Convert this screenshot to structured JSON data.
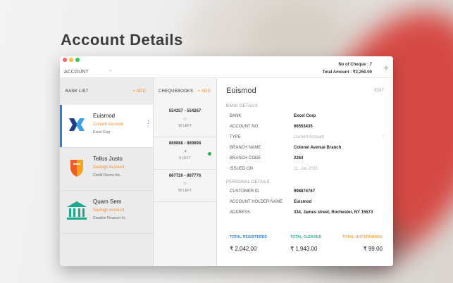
{
  "page": {
    "heading": "Account Details"
  },
  "toolbar": {
    "account_select": "ACCOUNT",
    "cheque_count_label": "No of Cheque :",
    "cheque_count": "7",
    "total_amount_label": "Total Amount :",
    "total_amount": "₹2,250.00",
    "add_symbol": "+"
  },
  "bank_list": {
    "header": "BANK LIST",
    "add_label": "+ ADD",
    "items": [
      {
        "name": "Euismod",
        "account_type": "Current Account",
        "subtitle": "Excel Corp",
        "logo": "x-chevron-logo",
        "selected": true
      },
      {
        "name": "Tellus Justo",
        "account_type": "Savings Account",
        "subtitle": "Credit Device Inc.",
        "logo": "shield-logo",
        "selected": false
      },
      {
        "name": "Quam Sem",
        "account_type": "Savings Account",
        "subtitle": "Creative Finance Inc.",
        "logo": "bank-building-logo",
        "selected": false
      }
    ]
  },
  "chequebooks": {
    "header": "CHEQUEBOOKS",
    "add_label": "+ ADD",
    "items": [
      {
        "range": "554257 - 554267",
        "left": "10 LEFT",
        "progress": 0.0,
        "active": false
      },
      {
        "range": "889888 - 889898",
        "left": "5 LEFT",
        "progress": 0.5,
        "active": true
      },
      {
        "range": "887726 - 887776",
        "left": "50 LEFT",
        "progress": 0.0,
        "active": false
      }
    ]
  },
  "detail": {
    "title": "Euismod",
    "edit_label": "EDIT",
    "bank_section": "BANK DETAILS",
    "bank_fields": [
      {
        "label": "BANK",
        "value": "Excel Corp"
      },
      {
        "label": "ACCOUNT NO.",
        "value": "66553435"
      },
      {
        "label": "TYPE",
        "value": "Current Account"
      },
      {
        "label": "BRANCH NAME",
        "value": "Colonel Avenue Branch"
      },
      {
        "label": "BRANCH CODE",
        "value": "2284"
      },
      {
        "label": "ISSUED ON",
        "value": "11, Jun 2015"
      }
    ],
    "personal_section": "PERSONAL DETAILS",
    "personal_fields": [
      {
        "label": "CUSTOMER ID",
        "value": "998874767"
      },
      {
        "label": "ACCOUNT HOLDER NAME",
        "value": "Euismod"
      },
      {
        "label": "ADDRESS",
        "value": "334, James street, Rochester, NY 15573"
      }
    ],
    "totals": [
      {
        "label": "TOTAL REGISTERED",
        "value": "₹ 2,042.00",
        "color": "#2a7de1"
      },
      {
        "label": "TOTAL CLEARED",
        "value": "₹ 1,943.00",
        "color": "#25b6a6"
      },
      {
        "label": "TOTAL OUTSTANDING",
        "value": "₹ 99.00",
        "color": "#f2a23a"
      }
    ]
  },
  "colors": {
    "accent_orange": "#f28b30",
    "accent_blue": "#2a7de1",
    "status_green": "#2fb34a"
  }
}
